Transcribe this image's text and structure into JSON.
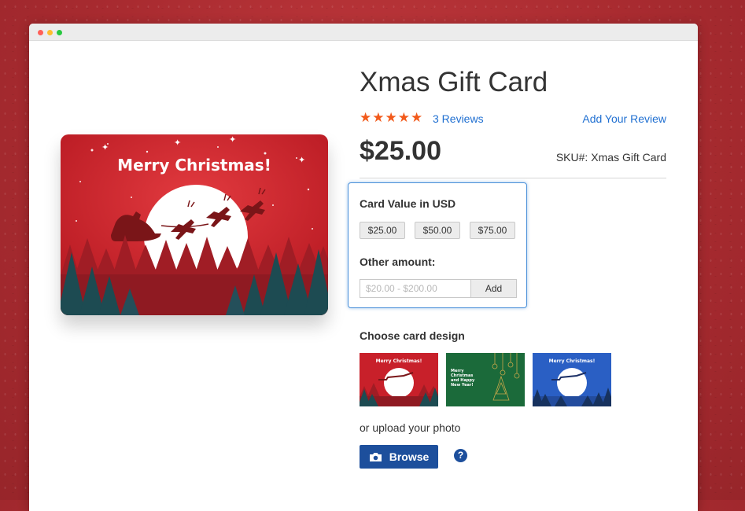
{
  "product": {
    "title": "Xmas Gift Card",
    "stars": "★★★★★",
    "reviews_label": "3 Reviews",
    "add_review_label": "Add Your Review",
    "price": "$25.00",
    "sku_label": "SKU#:",
    "sku_value": "Xmas Gift Card",
    "rating": 5,
    "rating_max": 5
  },
  "hero": {
    "greeting": "Merry Christmas!"
  },
  "card_value": {
    "label": "Card Value in USD",
    "amounts": [
      "$25.00",
      "$50.00",
      "$75.00"
    ],
    "other_label": "Other amount:",
    "other_placeholder": "$20.00 - $200.00",
    "add_label": "Add"
  },
  "design": {
    "label": "Choose card design",
    "thumbs": [
      {
        "text": "Merry Christmas!",
        "theme": "red"
      },
      {
        "text": "Merry Christmas and Happy New Year!",
        "theme": "green"
      },
      {
        "text": "Merry Christmas!",
        "theme": "blue"
      }
    ]
  },
  "upload": {
    "label": "or upload your photo",
    "browse_label": "Browse",
    "help_label": "?"
  },
  "colors": {
    "accent_blue": "#1f6fd1",
    "button_navy": "#1d4f9c",
    "star_orange": "#f25a1b",
    "card_red": "#c8202a",
    "card_green": "#1b6a3a",
    "card_blue": "#2a5fc4"
  }
}
